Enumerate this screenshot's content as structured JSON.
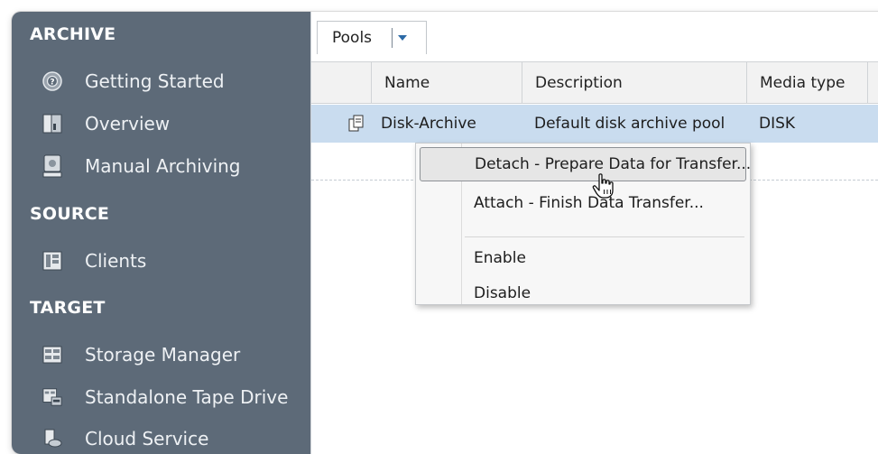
{
  "sidebar": {
    "sections": [
      {
        "title": "ARCHIVE",
        "items": [
          {
            "label": "Getting Started",
            "icon": "help-wheel-icon"
          },
          {
            "label": "Overview",
            "icon": "overview-book-icon"
          },
          {
            "label": "Manual Archiving",
            "icon": "manual-archiving-icon"
          }
        ]
      },
      {
        "title": "SOURCE",
        "items": [
          {
            "label": "Clients",
            "icon": "clients-icon"
          }
        ]
      },
      {
        "title": "TARGET",
        "items": [
          {
            "label": "Storage Manager",
            "icon": "storage-manager-icon"
          },
          {
            "label": "Standalone Tape Drive",
            "icon": "tape-drive-icon"
          },
          {
            "label": "Cloud Service",
            "icon": "cloud-service-icon"
          }
        ]
      }
    ]
  },
  "tabs": [
    {
      "label": "Pools",
      "dropdown_icon": "dropdown-arrow-icon"
    }
  ],
  "table": {
    "columns": [
      "Name",
      "Description",
      "Media type"
    ],
    "rows": [
      {
        "name": "Disk-Archive",
        "description": "Default disk archive pool",
        "media_type": "DISK",
        "icon": "pool-icon",
        "selected": true
      }
    ]
  },
  "context_menu": {
    "items": [
      {
        "label": "Detach - Prepare Data for Transfer...",
        "hovered": true
      },
      {
        "label": "Attach - Finish Data Transfer..."
      },
      {
        "label": "Enable"
      },
      {
        "label": "Disable"
      }
    ]
  },
  "colors": {
    "sidebar_bg": "#5d6a78",
    "selected_row": "#c9dcef",
    "menu_bg": "#f7f7f7",
    "accent": "#2c6aa6"
  },
  "cursor_icon": "hand-pointer-icon"
}
